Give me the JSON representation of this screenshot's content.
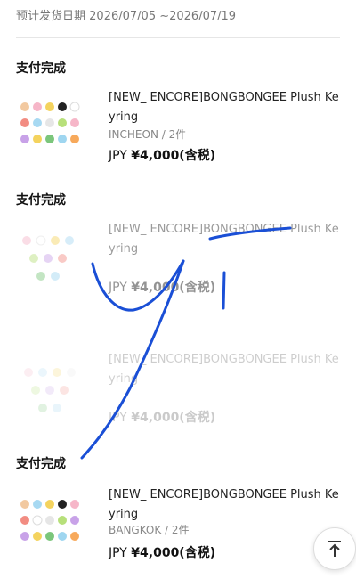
{
  "header": {
    "ship_date_label": "预计发货日期",
    "ship_date_range": "2026/07/05 ~2026/07/19"
  },
  "orders": [
    {
      "status": "支付完成",
      "title": "[NEW_ ENCORE]BONGBONGEE Plush Keyring",
      "variant": "INCHEON / 2件",
      "currency": "JPY",
      "price": "¥4,000(含税)"
    },
    {
      "status": "支付完成",
      "title": "[NEW_ ENCORE]BONGBONGEE Plush Keyring",
      "variant": "",
      "currency": "JPY",
      "price": "¥4,000(含税)"
    },
    {
      "status": "",
      "title": "[NEW_ ENCORE]BONGBONGEE Plush Keyring",
      "variant": "",
      "currency": "JPY",
      "price": "¥4,000(含税)"
    },
    {
      "status": "支付完成",
      "title": "[NEW_ ENCORE]BONGBONGEE Plush Keyring",
      "variant": "BANGKOK / 2件",
      "currency": "JPY",
      "price": "¥4,000(含税)"
    }
  ],
  "icons": {
    "scroll_top": "arrow-up-to-top-icon"
  },
  "colors": {
    "annotation_ink": "#1a4fd6"
  }
}
